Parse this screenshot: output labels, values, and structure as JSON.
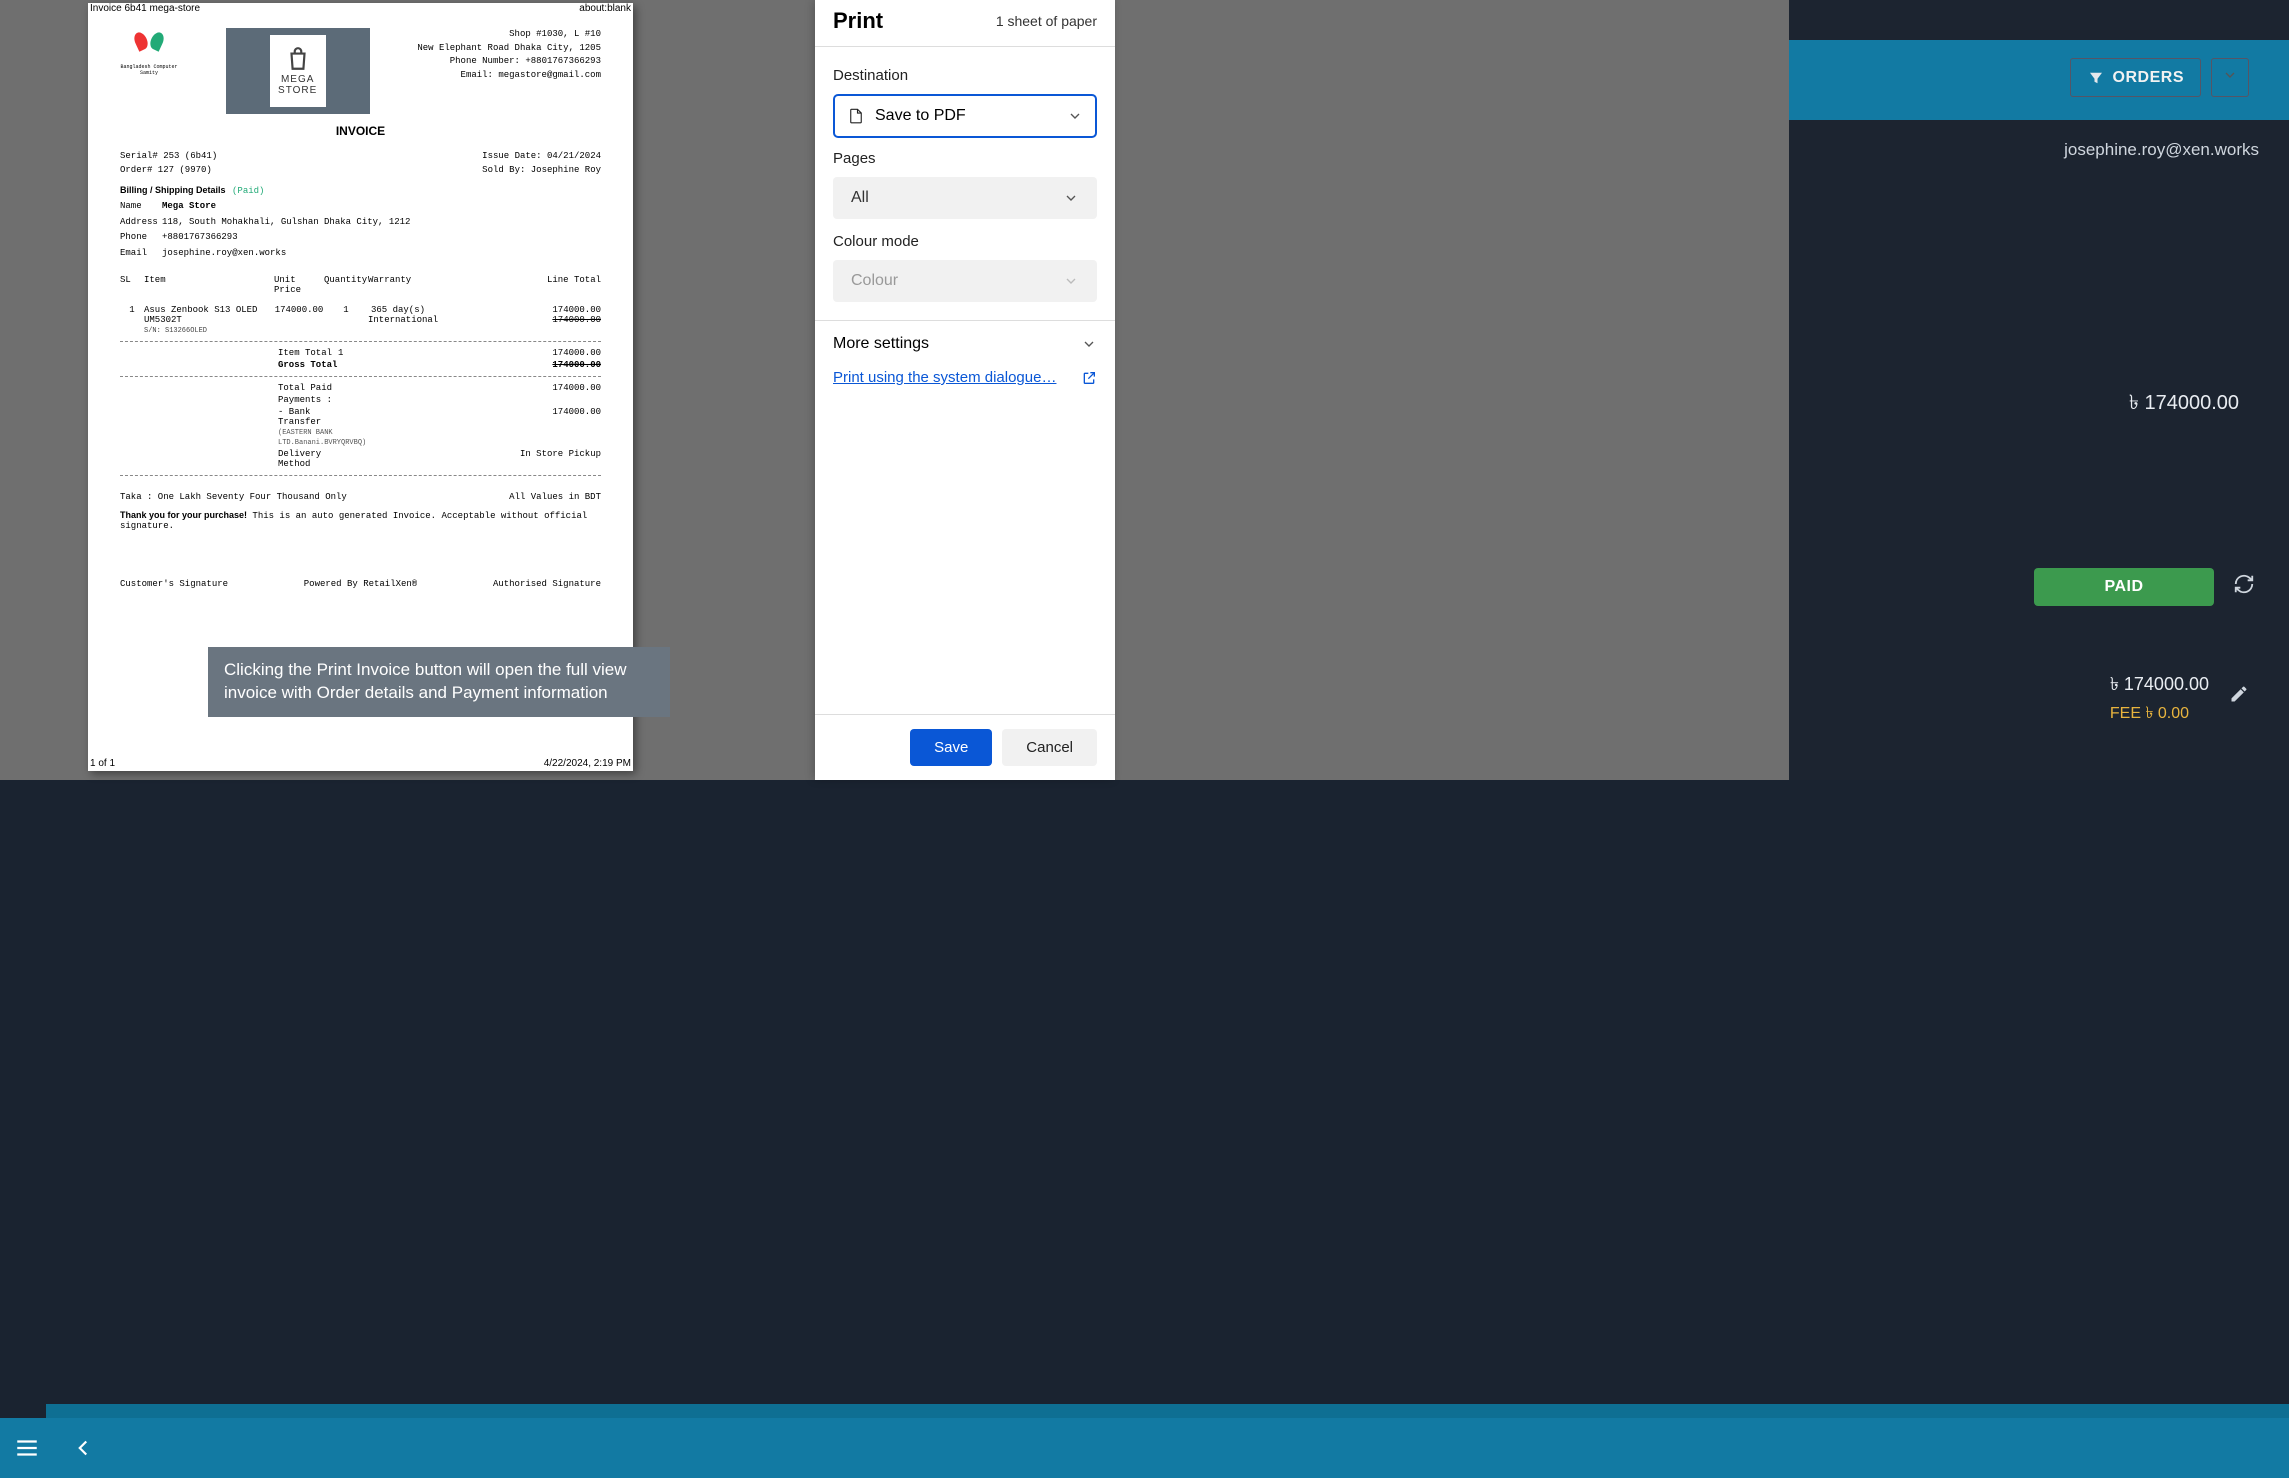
{
  "preview": {
    "doc_title": "Invoice 6b41 mega-store",
    "url": "about:blank",
    "page_of": "1 of 1",
    "timestamp": "4/22/2024, 2:19 PM",
    "bcs_caption": "Bangladesh Computer Samity",
    "logo_line1": "MEGA",
    "logo_line2": "STORE",
    "addr1": "Shop #1030, L #10",
    "addr2": "New Elephant Road Dhaka City, 1205",
    "addr3": "Phone Number: +8801767366293",
    "addr4": "Email: megastore@gmail.com",
    "title": "INVOICE",
    "serial": "Serial# 253 (6b41)",
    "order": "Order# 127 (9970)",
    "issue": "Issue Date: 04/21/2024",
    "soldby": "Sold By: Josephine Roy",
    "sect": "Billing / Shipping Details",
    "paid": "(Paid)",
    "kv": {
      "name_k": "Name",
      "name_v": "Mega Store",
      "addr_k": "Address",
      "addr_v": "118, South Mohakhali, Gulshan Dhaka City, 1212",
      "phone_k": "Phone",
      "phone_v": "+8801767366293",
      "email_k": "Email",
      "email_v": "josephine.roy@xen.works"
    },
    "th": {
      "sl": "SL",
      "item": "Item",
      "up": "Unit Price",
      "qty": "Quantity",
      "war": "Warranty",
      "lt": "Line Total"
    },
    "item": {
      "sl": "1",
      "name": "Asus Zenbook S13 OLED UM5302T",
      "sn": "S/N: S13266OLED",
      "up": "174000.00",
      "qty": "1",
      "war1": "365 day(s)",
      "war2": "International",
      "lt1": "174000.00",
      "lt2": "174000.00"
    },
    "sum": {
      "it": "Item Total",
      "it_q": "1",
      "it_v": "174000.00",
      "gt": "Gross Total",
      "gt_v": "174000.00",
      "tp": "Total Paid",
      "tp_v": "174000.00",
      "pay": "Payments :",
      "bt": "- Bank Transfer",
      "bt_d": "(EASTERN BANK LTD.Banani.BVRYQRVBQ)",
      "bt_v": "174000.00",
      "dm": "Delivery Method",
      "dm_v": "In Store Pickup"
    },
    "words_l": "Taka : One Lakh Seventy Four Thousand Only",
    "words_r": "All Values in BDT",
    "thanks_b": "Thank you for your purchase!",
    "thanks_t": " This is an auto generated Invoice. Acceptable without official signature.",
    "sig_l": "Customer's Signature",
    "sig_c": "Powered By RetailXen®",
    "sig_r": "Authorised Signature",
    "tooltip": "Clicking the Print Invoice button will open the full view invoice with Order details and Payment information"
  },
  "dialog": {
    "title": "Print",
    "sheets": "1 sheet of paper",
    "dest_lbl": "Destination",
    "dest_val": "Save to PDF",
    "pages_lbl": "Pages",
    "pages_val": "All",
    "color_lbl": "Colour mode",
    "color_val": "Colour",
    "more": "More settings",
    "sys": "Print using the system dialogue…",
    "save": "Save",
    "cancel": "Cancel"
  },
  "bg": {
    "orders": "ORDERS",
    "email": "josephine.roy@xen.works",
    "amt1": "৳ 174000.00",
    "paid": "PAID",
    "amt2": "৳ 174000.00",
    "fee": "FEE ৳ 0.00"
  }
}
